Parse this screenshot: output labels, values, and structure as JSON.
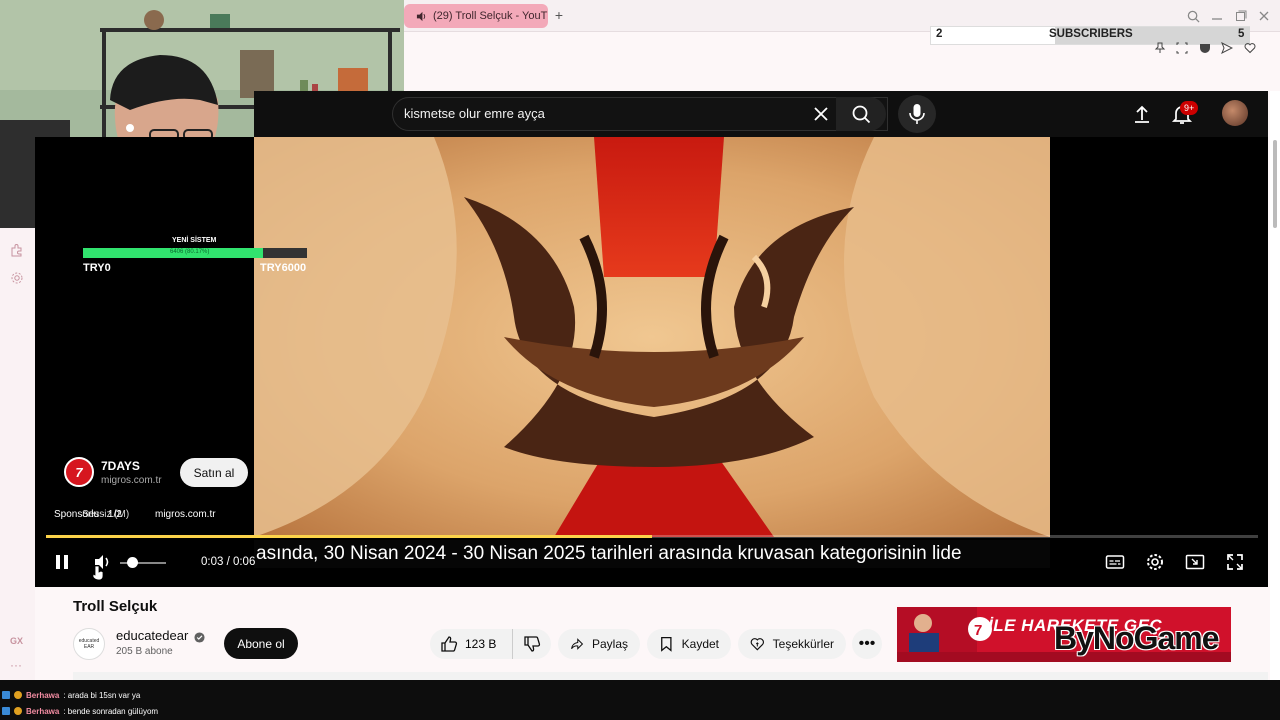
{
  "browser": {
    "tab_title": "(29) Troll Selçuk - YouT",
    "new_tab": "+"
  },
  "subscriber_goal": {
    "current": "2",
    "label": "SUBSCRIBERS",
    "target": "5"
  },
  "donation_goal": {
    "title": "YENİ SİSTEM",
    "progress_text": "6406 (80.17%)",
    "progress_fraction": 0.8017,
    "min_label": "TRY0",
    "max_label": "TRY6000"
  },
  "search": {
    "query": "kismetse olur emre ayça"
  },
  "notifications": {
    "badge": "9+"
  },
  "ad": {
    "brand_logo": "7",
    "brand_name": "7DAYS",
    "domain": "migros.com.tr",
    "cta": "Satın al",
    "info_text": "Sponsorlu · 1/2",
    "info_overlap": "Sessiz (M)",
    "info_domain": "migros.com.tr"
  },
  "player": {
    "subtitle": "asında, 30 Nisan 2024 - 30 Nisan 2025 tarihleri arasında kruvasan kategorisinin lide",
    "time": "0:03 / 0:06",
    "progress_fraction": 0.5,
    "volume_fraction": 0.25
  },
  "video": {
    "title": "Troll Selçuk",
    "channel_name": "educatedear",
    "channel_avatar_text": "educated EAR",
    "channel_subs": "205 B abone",
    "subscribe_label": "Abone ol",
    "likes": "123 B",
    "share_label": "Paylaş",
    "save_label": "Kaydet",
    "thanks_label": "Teşekkürler",
    "more": "•••"
  },
  "banner_ad": {
    "text": "İLE HAREKETE GEÇ",
    "watermark": "ByNoGame"
  },
  "chat": [
    {
      "user": "Berhawa",
      "message": ": arada bi 15sn var ya"
    },
    {
      "user": "Berhawa",
      "message": ": bende sonradan gülüyom"
    }
  ],
  "sidebar": {
    "gx_label": "GX",
    "more": "···"
  },
  "colors": {
    "youtube_dark": "#0f0f0f",
    "tab_pink": "#f3a9b9",
    "goal_green": "#31e36e",
    "progress_yellow": "#fcd34a",
    "ad_red": "#d0112b"
  }
}
